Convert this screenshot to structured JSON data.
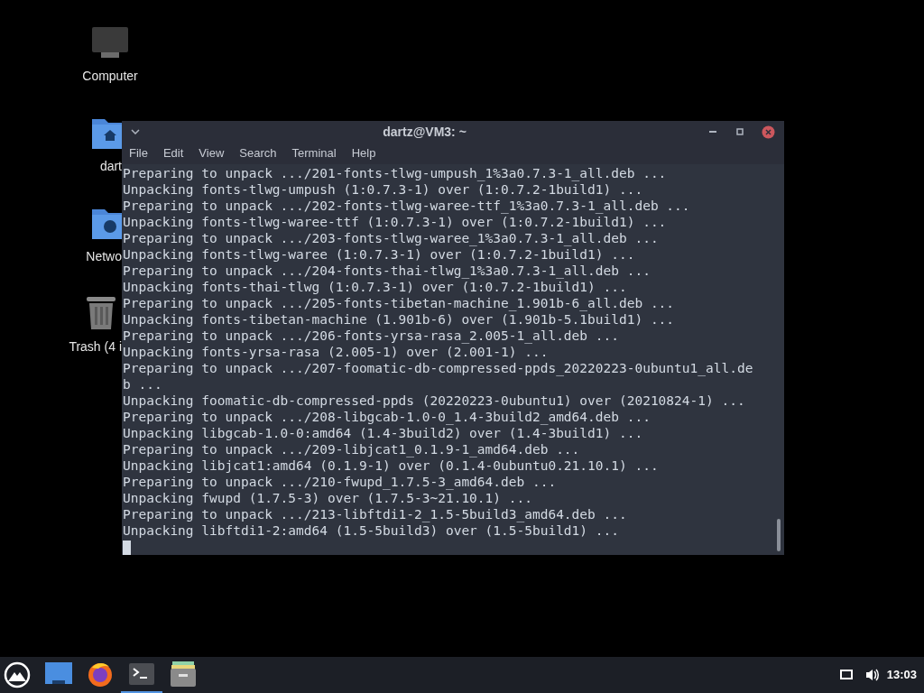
{
  "desktop_icons": [
    {
      "kind": "computer",
      "label": "Computer"
    },
    {
      "kind": "home",
      "label": "dart"
    },
    {
      "kind": "network",
      "label": "Netwo"
    },
    {
      "kind": "trash",
      "label": "Trash (4 i"
    }
  ],
  "window": {
    "title": "dartz@VM3: ~",
    "menu": [
      "File",
      "Edit",
      "View",
      "Search",
      "Terminal",
      "Help"
    ],
    "lines": [
      "Preparing to unpack .../201-fonts-tlwg-umpush_1%3a0.7.3-1_all.deb ...",
      "Unpacking fonts-tlwg-umpush (1:0.7.3-1) over (1:0.7.2-1build1) ...",
      "Preparing to unpack .../202-fonts-tlwg-waree-ttf_1%3a0.7.3-1_all.deb ...",
      "Unpacking fonts-tlwg-waree-ttf (1:0.7.3-1) over (1:0.7.2-1build1) ...",
      "Preparing to unpack .../203-fonts-tlwg-waree_1%3a0.7.3-1_all.deb ...",
      "Unpacking fonts-tlwg-waree (1:0.7.3-1) over (1:0.7.2-1build1) ...",
      "Preparing to unpack .../204-fonts-thai-tlwg_1%3a0.7.3-1_all.deb ...",
      "Unpacking fonts-thai-tlwg (1:0.7.3-1) over (1:0.7.2-1build1) ...",
      "Preparing to unpack .../205-fonts-tibetan-machine_1.901b-6_all.deb ...",
      "Unpacking fonts-tibetan-machine (1.901b-6) over (1.901b-5.1build1) ...",
      "Preparing to unpack .../206-fonts-yrsa-rasa_2.005-1_all.deb ...",
      "Unpacking fonts-yrsa-rasa (2.005-1) over (2.001-1) ...",
      "Preparing to unpack .../207-foomatic-db-compressed-ppds_20220223-0ubuntu1_all.de",
      "b ...",
      "Unpacking foomatic-db-compressed-ppds (20220223-0ubuntu1) over (20210824-1) ...",
      "Preparing to unpack .../208-libgcab-1.0-0_1.4-3build2_amd64.deb ...",
      "Unpacking libgcab-1.0-0:amd64 (1.4-3build2) over (1.4-3build1) ...",
      "Preparing to unpack .../209-libjcat1_0.1.9-1_amd64.deb ...",
      "Unpacking libjcat1:amd64 (0.1.9-1) over (0.1.4-0ubuntu0.21.10.1) ...",
      "Preparing to unpack .../210-fwupd_1.7.5-3_amd64.deb ...",
      "Unpacking fwupd (1.7.5-3) over (1.7.5-3~21.10.1) ...",
      "Preparing to unpack .../213-libftdi1-2_1.5-5build3_amd64.deb ...",
      "Unpacking libftdi1-2:amd64 (1.5-5build3) over (1.5-5build1) ..."
    ]
  },
  "taskbar": {
    "apps": [
      {
        "kind": "desktop",
        "selected": false
      },
      {
        "kind": "browser",
        "selected": false
      },
      {
        "kind": "terminal",
        "selected": true
      },
      {
        "kind": "files",
        "selected": false
      }
    ],
    "clock": "13:03"
  }
}
